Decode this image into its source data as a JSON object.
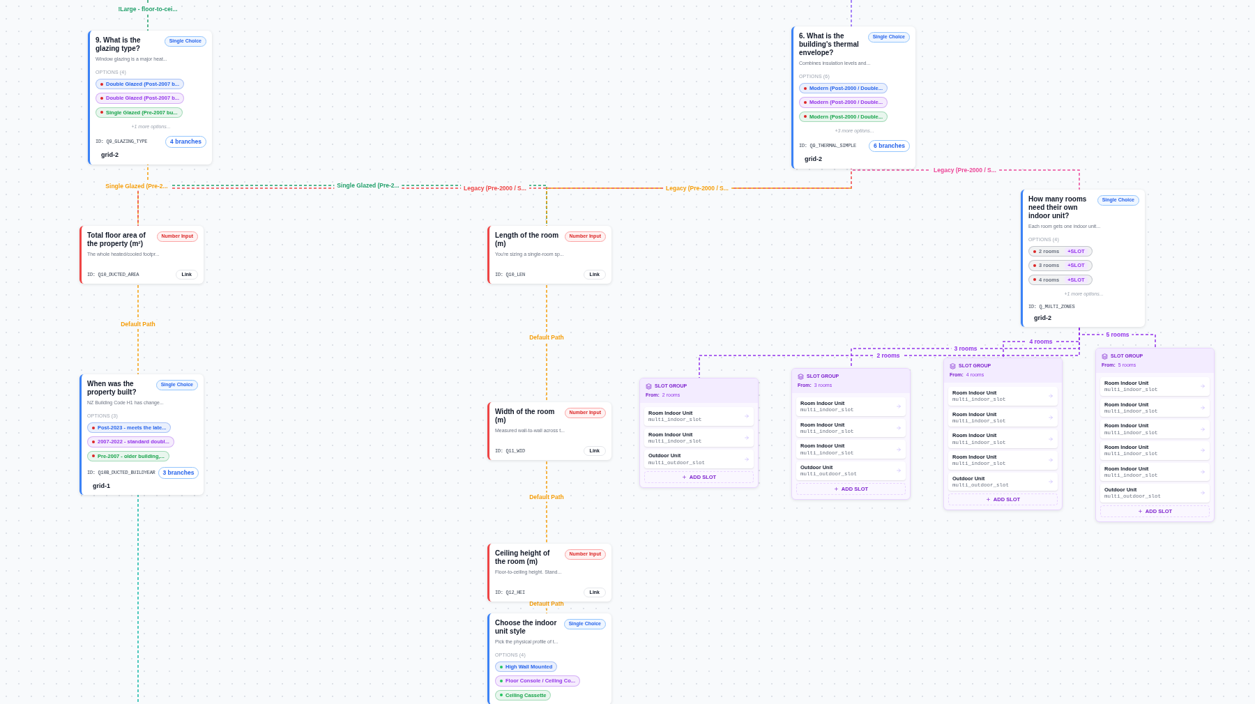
{
  "nodes": [
    {
      "kind": "single_choice",
      "title": "9. What is the glazing type?",
      "badge": "Single Choice",
      "description": "Window glazing is a major heat...",
      "options_label": "OPTIONS (4)",
      "options": [
        {
          "label": "Double Glazed (Post-2007 b...",
          "color": "#2563eb",
          "branched": true
        },
        {
          "label": "Double Glazed (Post-2007 b...",
          "color": "#9333ea",
          "branched": true
        },
        {
          "label": "Single Glazed (Pre-2007 bu...",
          "color": "#16a34a",
          "branched": true
        }
      ],
      "more": "+1 more options...",
      "id": "ID: Q9_GLAZING_TYPE",
      "branches": "4 branches",
      "grid": "grid-2"
    },
    {
      "kind": "single_choice",
      "title": "6. What is the building's thermal envelope?",
      "badge": "Single Choice",
      "description": "Combines insulation levels and...",
      "options_label": "OPTIONS (6)",
      "options": [
        {
          "label": "Modern (Post-2000 / Double...",
          "color": "#2563eb",
          "branched": true
        },
        {
          "label": "Modern (Post-2000 / Double...",
          "color": "#9333ea",
          "branched": true
        },
        {
          "label": "Modern (Post-2000 / Double...",
          "color": "#16a34a",
          "branched": true
        }
      ],
      "more": "+3 more options...",
      "id": "ID: Q9_THERMAL_SIMPLE",
      "branches": "6 branches",
      "grid": "grid-2"
    },
    {
      "kind": "single_choice",
      "title": "How many rooms need their own indoor unit?",
      "badge": "Single Choice",
      "description": "Each room gets one indoor unit...",
      "options_label": "OPTIONS (4)",
      "options": [
        {
          "label": "2 rooms",
          "color": "#6b7280",
          "branched": true,
          "slot": "+SLOT"
        },
        {
          "label": "3 rooms",
          "color": "#6b7280",
          "branched": true,
          "slot": "+SLOT"
        },
        {
          "label": "4 rooms",
          "color": "#6b7280",
          "branched": true,
          "slot": "+SLOT"
        }
      ],
      "more": "+1 more options...",
      "id": "ID: Q_MULTI_ZONES",
      "grid": "grid-2"
    },
    {
      "kind": "number_input",
      "title": "Total floor area of the property (m²)",
      "badge": "Number Input",
      "description": "The whole heated/cooled footpr...",
      "id": "ID: Q10_DUCTED_AREA",
      "link": "Link"
    },
    {
      "kind": "single_choice",
      "title": "When was the property built?",
      "badge": "Single Choice",
      "description": "NZ Building Code H1 has change...",
      "options_label": "OPTIONS (3)",
      "options": [
        {
          "label": "Post-2023 - meets the late...",
          "color": "#2563eb",
          "branched": true
        },
        {
          "label": "2007-2022 - standard doubl...",
          "color": "#9333ea",
          "branched": true
        },
        {
          "label": "Pre-2007 - older building,...",
          "color": "#16a34a",
          "branched": true
        }
      ],
      "id": "ID: Q10B_DUCTED_BUILDYEAR",
      "branches": "3 branches",
      "grid": "grid-1"
    },
    {
      "kind": "number_input",
      "title": "Length of the room (m)",
      "badge": "Number Input",
      "description": "You're sizing a single-room sp...",
      "id": "ID: Q10_LEN",
      "link": "Link"
    },
    {
      "kind": "number_input",
      "title": "Width of the room (m)",
      "badge": "Number Input",
      "description": "Measured wall-to-wall across t...",
      "id": "ID: Q11_WID",
      "link": "Link"
    },
    {
      "kind": "number_input",
      "title": "Ceiling height of the room (m)",
      "badge": "Number Input",
      "description": "Floor-to-ceiling height. Stand...",
      "id": "ID: Q12_HEI",
      "link": "Link"
    },
    {
      "kind": "single_choice",
      "title": "Choose the indoor unit style",
      "badge": "Single Choice",
      "description": "Pick the physical profile of t...",
      "options_label": "OPTIONS (4)",
      "options": [
        {
          "label": "High Wall Mounted",
          "color": "#2563eb",
          "branched": false
        },
        {
          "label": "Floor Console / Ceiling Co...",
          "color": "#9333ea",
          "branched": false
        },
        {
          "label": "Ceiling Cassette",
          "color": "#16a34a",
          "branched": false
        }
      ]
    },
    {
      "kind": "slot_group",
      "title": "SLOT GROUP",
      "from_label": "From:",
      "from": "2 rooms",
      "slots": [
        {
          "name": "Room Indoor Unit",
          "key": "multi_indoor_slot"
        },
        {
          "name": "Room Indoor Unit",
          "key": "multi_indoor_slot"
        },
        {
          "name": "Outdoor Unit",
          "key": "multi_outdoor_slot"
        }
      ],
      "add": "ADD SLOT"
    },
    {
      "kind": "slot_group",
      "title": "SLOT GROUP",
      "from_label": "From:",
      "from": "3 rooms",
      "slots": [
        {
          "name": "Room Indoor Unit",
          "key": "multi_indoor_slot"
        },
        {
          "name": "Room Indoor Unit",
          "key": "multi_indoor_slot"
        },
        {
          "name": "Room Indoor Unit",
          "key": "multi_indoor_slot"
        },
        {
          "name": "Outdoor Unit",
          "key": "multi_outdoor_slot"
        }
      ],
      "add": "ADD SLOT"
    },
    {
      "kind": "slot_group",
      "title": "SLOT GROUP",
      "from_label": "From:",
      "from": "4 rooms",
      "slots": [
        {
          "name": "Room Indoor Unit",
          "key": "multi_indoor_slot"
        },
        {
          "name": "Room Indoor Unit",
          "key": "multi_indoor_slot"
        },
        {
          "name": "Room Indoor Unit",
          "key": "multi_indoor_slot"
        },
        {
          "name": "Room Indoor Unit",
          "key": "multi_indoor_slot"
        },
        {
          "name": "Outdoor Unit",
          "key": "multi_outdoor_slot"
        }
      ],
      "add": "ADD SLOT"
    },
    {
      "kind": "slot_group",
      "title": "SLOT GROUP",
      "from_label": "From:",
      "from": "5 rooms",
      "slots": [
        {
          "name": "Room Indoor Unit",
          "key": "multi_indoor_slot"
        },
        {
          "name": "Room Indoor Unit",
          "key": "multi_indoor_slot"
        },
        {
          "name": "Room Indoor Unit",
          "key": "multi_indoor_slot"
        },
        {
          "name": "Room Indoor Unit",
          "key": "multi_indoor_slot"
        },
        {
          "name": "Room Indoor Unit",
          "key": "multi_indoor_slot"
        },
        {
          "name": "Outdoor Unit",
          "key": "multi_outdoor_slot"
        }
      ],
      "add": "ADD SLOT"
    }
  ],
  "edges": [
    {
      "label": "!Large - floor-to-cei...",
      "color": "#22a06b"
    },
    {
      "label": "Single Glazed (Pre-2...",
      "color": "#f59e0b"
    },
    {
      "label": "Single Glazed (Pre-2...",
      "color": "#22a06b"
    },
    {
      "label": "Legacy (Pre-2000 / S...",
      "color": "#ef4444"
    },
    {
      "label": "Legacy (Pre-2000 / S...",
      "color": "#f59e0b"
    },
    {
      "label": "Legacy (Pre-2000 / S...",
      "color": "#ec4899"
    },
    {
      "label": "Default Path",
      "color": "#f59e0b"
    },
    {
      "label": "Default Path",
      "color": "#f59e0b"
    },
    {
      "label": "Default Path",
      "color": "#f59e0b"
    },
    {
      "label": "Default Path",
      "color": "#f59e0b"
    },
    {
      "label": "2 rooms",
      "color": "#9333ea"
    },
    {
      "label": "3 rooms",
      "color": "#9333ea"
    },
    {
      "label": "4 rooms",
      "color": "#9333ea"
    },
    {
      "label": "5 rooms",
      "color": "#9333ea"
    }
  ]
}
